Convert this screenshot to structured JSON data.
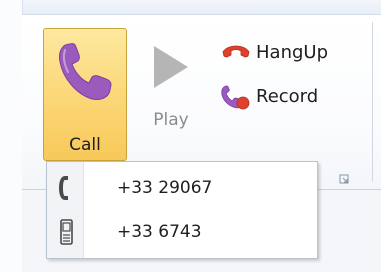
{
  "ribbon": {
    "call": {
      "label": "Call",
      "icon": "phone-handset-icon"
    },
    "play": {
      "label": "Play",
      "icon": "play-icon"
    },
    "hangup": {
      "label": "HangUp",
      "icon": "hangup-icon"
    },
    "record": {
      "label": "Record",
      "icon": "record-icon"
    },
    "launcher_icon": "dialog-launcher-icon"
  },
  "dropdown": {
    "items": [
      {
        "number": "+33 29067",
        "icon": "landline-phone-icon"
      },
      {
        "number": "+33 6743",
        "icon": "mobile-phone-icon"
      }
    ]
  },
  "colors": {
    "phone_purple": "#9a5bbd",
    "hangup_red": "#e0412f",
    "pressed_button": "#fcd97c",
    "play_gray": "#b5b5b5"
  }
}
